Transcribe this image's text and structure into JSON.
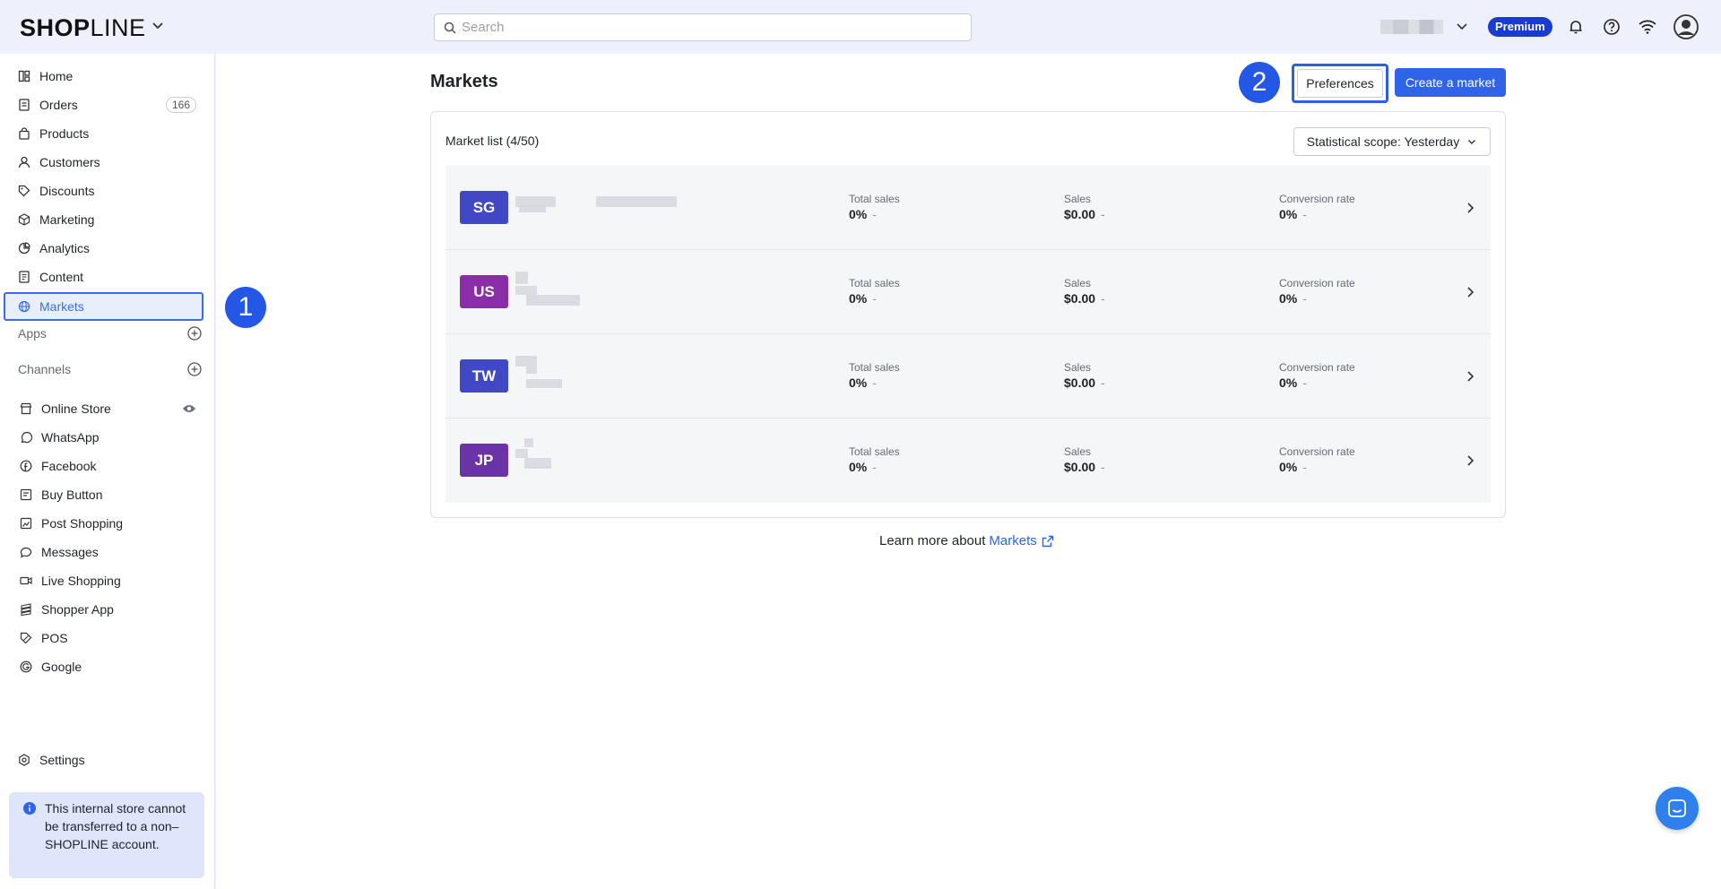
{
  "brand": {
    "logo_bold": "SHOP",
    "logo_thin": "LINE"
  },
  "search": {
    "placeholder": "Search"
  },
  "header": {
    "premium_label": "Premium"
  },
  "sidebar": {
    "items": [
      {
        "label": "Home",
        "icon": "home-icon"
      },
      {
        "label": "Orders",
        "icon": "orders-icon",
        "count": "166"
      },
      {
        "label": "Products",
        "icon": "bag-icon"
      },
      {
        "label": "Customers",
        "icon": "user-icon"
      },
      {
        "label": "Discounts",
        "icon": "tag-icon"
      },
      {
        "label": "Marketing",
        "icon": "megaphone-icon"
      },
      {
        "label": "Analytics",
        "icon": "chart-icon"
      },
      {
        "label": "Content",
        "icon": "document-icon"
      },
      {
        "label": "Markets",
        "icon": "globe-icon",
        "active": true
      }
    ],
    "apps_label": "Apps",
    "channels_label": "Channels",
    "channels": [
      {
        "label": "Online Store",
        "icon": "store-icon"
      },
      {
        "label": "WhatsApp",
        "icon": "whatsapp-icon"
      },
      {
        "label": "Facebook",
        "icon": "facebook-icon"
      },
      {
        "label": "Buy Button",
        "icon": "buy-button-icon"
      },
      {
        "label": "Post Shopping",
        "icon": "post-icon"
      },
      {
        "label": "Messages",
        "icon": "messages-icon"
      },
      {
        "label": "Live Shopping",
        "icon": "video-icon"
      },
      {
        "label": "Shopper App",
        "icon": "app-icon"
      },
      {
        "label": "POS",
        "icon": "pos-icon"
      },
      {
        "label": "Google",
        "icon": "google-icon"
      }
    ],
    "settings_label": "Settings",
    "notice": "This internal store cannot be transferred to a non–SHOPLINE account."
  },
  "annotations": {
    "one": "1",
    "two": "2"
  },
  "page": {
    "title": "Markets",
    "preferences_label": "Preferences",
    "create_label": "Create a market"
  },
  "market_list": {
    "title": "Market list (4/50)",
    "scope_label": "Statistical scope: Yesterday",
    "rows": [
      {
        "code": "SG",
        "color": "#4048c6",
        "total_sales_label": "Total sales",
        "total_sales": "0%",
        "sales_label": "Sales",
        "sales": "$0.00",
        "conversion_label": "Conversion rate",
        "conversion": "0%",
        "dash": "-"
      },
      {
        "code": "US",
        "color": "#8a2da8",
        "total_sales_label": "Total sales",
        "total_sales": "0%",
        "sales_label": "Sales",
        "sales": "$0.00",
        "conversion_label": "Conversion rate",
        "conversion": "0%",
        "dash": "-"
      },
      {
        "code": "TW",
        "color": "#4048c6",
        "total_sales_label": "Total sales",
        "total_sales": "0%",
        "sales_label": "Sales",
        "sales": "$0.00",
        "conversion_label": "Conversion rate",
        "conversion": "0%",
        "dash": "-"
      },
      {
        "code": "JP",
        "color": "#6a33a8",
        "total_sales_label": "Total sales",
        "total_sales": "0%",
        "sales_label": "Sales",
        "sales": "$0.00",
        "conversion_label": "Conversion rate",
        "conversion": "0%",
        "dash": "-"
      }
    ]
  },
  "footer": {
    "learn_text": "Learn more about",
    "learn_link": "Markets"
  },
  "colors": {
    "accent": "#2f63e8",
    "annotation": "#2457e6",
    "premium": "#1a3bd1"
  }
}
